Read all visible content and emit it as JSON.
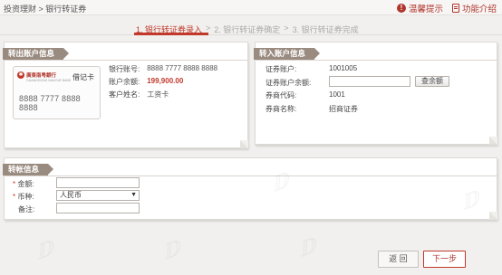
{
  "topbar": {
    "breadcrumb": "投资理财 > 银行转证券",
    "links": [
      {
        "label": "温馨提示",
        "icon": "alert-icon"
      },
      {
        "label": "功能介绍",
        "icon": "book-icon"
      }
    ]
  },
  "steps": {
    "items": [
      "1. 银行转证券录入",
      "2. 银行转证券确定",
      "3. 银行转证券完成"
    ],
    "separator": ">",
    "active_index": 0
  },
  "out_panel": {
    "title": "转出账户信息",
    "card": {
      "bank_name": "廣東南粤銀行",
      "bank_sub": "GUANGDONG NANYUE BANK",
      "type": "借记卡",
      "number": "8888 7777  8888 8888"
    },
    "account_no_label": "银行账号:",
    "account_no": "8888 7777 8888 8888",
    "balance_label": "账户余额:",
    "balance": "199,900.00",
    "customer_label": "客户姓名:",
    "customer": "工资卡"
  },
  "in_panel": {
    "title": "转入账户信息",
    "sec_account_label": "证券账户:",
    "sec_account": "1001005",
    "sec_balance_label": "证券账户余额:",
    "sec_balance_value": "",
    "query_button": "查余额",
    "broker_code_label": "券商代码:",
    "broker_code": "1001",
    "broker_name_label": "券商名称:",
    "broker_name": "招商证券"
  },
  "transfer_panel": {
    "title": "转帐信息",
    "amount_label": "金额:",
    "amount_value": "",
    "currency_label": "币种:",
    "currency_value": "人民币",
    "remark_label": "备注:",
    "remark_value": ""
  },
  "buttons": {
    "back": "返 回",
    "next": "下一步"
  },
  "colors": {
    "accent": "#c0392b",
    "ribbon": "#9a8b80",
    "background": "#f1f0ee"
  }
}
